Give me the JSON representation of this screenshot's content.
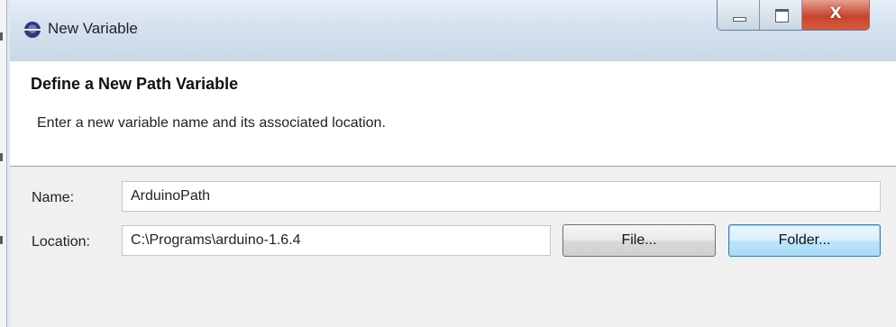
{
  "window": {
    "title": "New Variable",
    "caption": {
      "minimize": "",
      "maximize": "",
      "close": "X"
    }
  },
  "banner": {
    "heading": "Define a New Path Variable",
    "description": "Enter a new variable name and its associated location."
  },
  "form": {
    "name_label": "Name:",
    "name_value": "ArduinoPath",
    "location_label": "Location:",
    "location_value": "C:\\Programs\\arduino-1.6.4",
    "file_button": "File...",
    "folder_button": "Folder..."
  },
  "icons": {
    "app": "eclipse-logo-icon",
    "minimize": "minimize-icon",
    "maximize": "maximize-icon",
    "close": "close-icon"
  },
  "colors": {
    "close_button": "#c8452d",
    "default_button_border": "#3c7fb1",
    "titlebar": "#d4e1ee"
  }
}
